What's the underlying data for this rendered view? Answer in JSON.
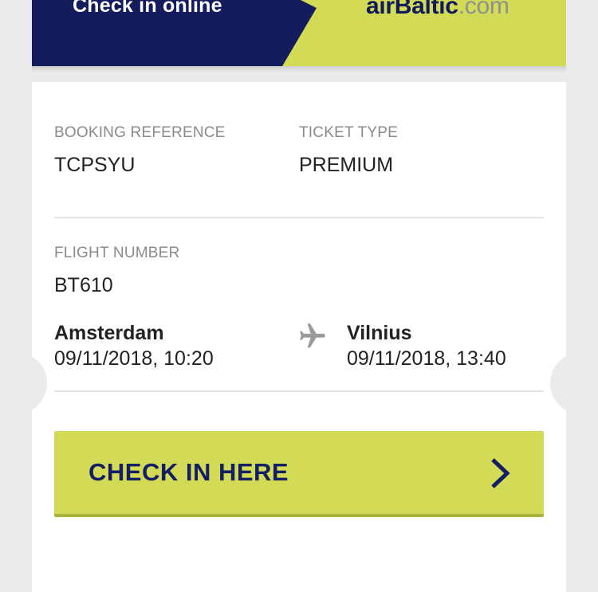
{
  "header": {
    "title": "Check in online",
    "logo_brand": "airBaltic",
    "logo_domain": ".com",
    "colors": {
      "navy": "#141c5e",
      "lime": "#d3db56"
    }
  },
  "booking": {
    "reference_label": "BOOKING REFERENCE",
    "reference_value": "TCPSYU",
    "ticket_type_label": "TICKET TYPE",
    "ticket_type_value": "PREMIUM"
  },
  "flight": {
    "number_label": "FLIGHT NUMBER",
    "number_value": "BT610",
    "departure_city": "Amsterdam",
    "departure_datetime": "09/11/2018, 10:20",
    "arrival_city": "Vilnius",
    "arrival_datetime": "09/11/2018, 13:40",
    "route_icon": "plane-icon"
  },
  "action": {
    "checkin_label": "CHECK IN HERE",
    "checkin_icon": "chevron-right-icon"
  }
}
